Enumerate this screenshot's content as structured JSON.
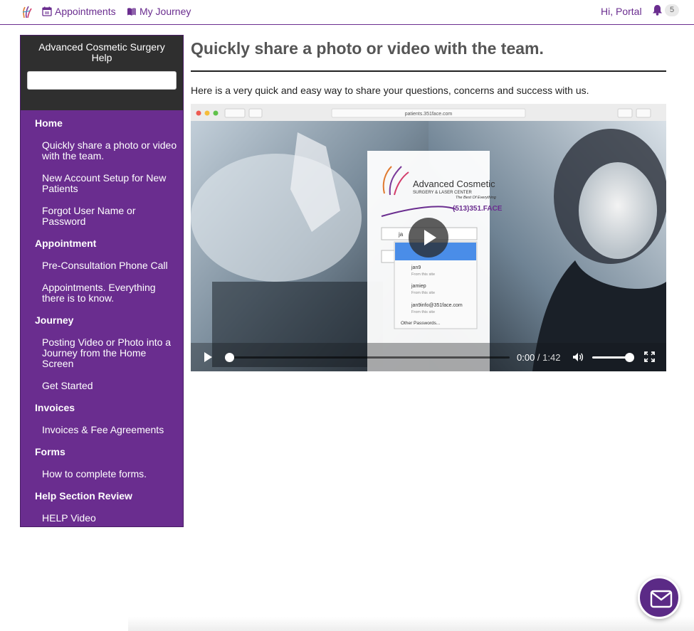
{
  "topnav": {
    "appointments_label": "Appointments",
    "journey_label": "My Journey",
    "greeting": "Hi, Portal",
    "notification_count": "5"
  },
  "sidebar": {
    "title": "Advanced Cosmetic Surgery Help",
    "search_placeholder": "",
    "sections": [
      {
        "label": "Home",
        "items": [
          "Quickly share a photo or video with the team.",
          "New Account Setup for New Patients",
          "Forgot User Name or Password"
        ]
      },
      {
        "label": "Appointment",
        "items": [
          "Pre-Consultation Phone Call",
          "Appointments. Everything there is to know."
        ]
      },
      {
        "label": "Journey",
        "items": [
          "Posting Video or Photo into a Journey from the Home Screen",
          "Get Started"
        ]
      },
      {
        "label": "Invoices",
        "items": [
          "Invoices & Fee Agreements"
        ]
      },
      {
        "label": "Forms",
        "items": [
          "How to complete forms."
        ]
      },
      {
        "label": "Help Section Review",
        "items": [
          "HELP Video"
        ]
      }
    ]
  },
  "main": {
    "title": "Quickly share a photo or video with the team.",
    "intro": "Here is a very quick and easy way to share your questions, concerns and success with us."
  },
  "video": {
    "current_time": "0:00",
    "separator": " / ",
    "duration": "1:42",
    "progress": 0.0,
    "volume": 0.85,
    "frame": {
      "url_bar": "patients.351face.com",
      "brand_line1": "Advanced Cosmetic",
      "brand_line2": "SURGERY & LASER CENTER",
      "brand_tagline": "The Best Of Everything",
      "brand_phone": "(513)351.FACE",
      "username_value": "ja",
      "autocomplete": [
        {
          "name": "jan9",
          "sub": "From this site"
        },
        {
          "name": "jamiep",
          "sub": "From this site"
        },
        {
          "name": "jan9info@351face.com",
          "sub": "From this site"
        }
      ],
      "other_passwords": "Other Passwords..."
    }
  },
  "colors": {
    "brand_purple": "#6a2d8f",
    "sidebar_header": "#2f2f2f",
    "chat_button": "#5b2a86"
  },
  "icons": [
    "logo-icon",
    "calendar-icon",
    "book-icon",
    "bell-icon",
    "play-icon",
    "volume-icon",
    "fullscreen-icon",
    "mail-icon"
  ]
}
